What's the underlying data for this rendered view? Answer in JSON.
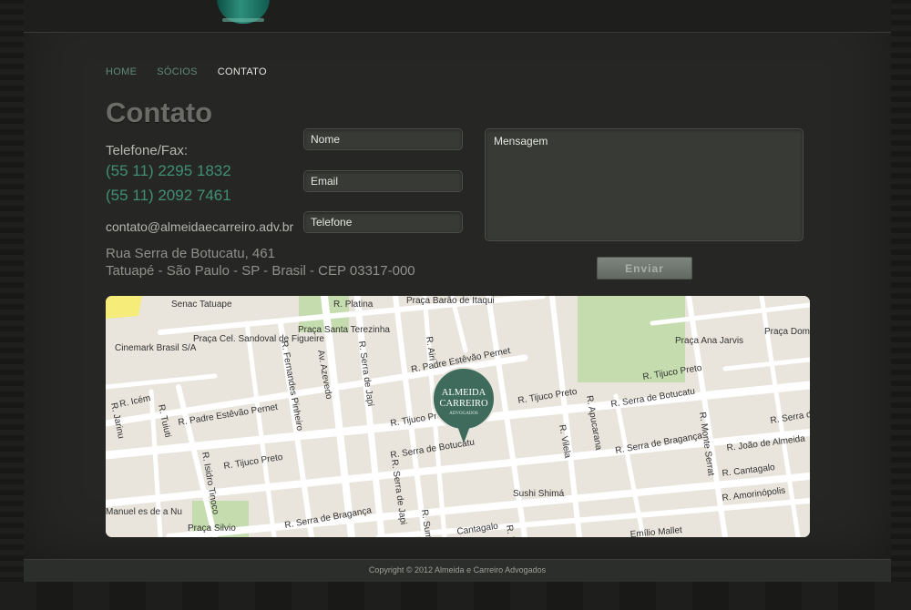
{
  "brand_mark_text": "ALMEIDA CARREIRO",
  "nav": {
    "items": [
      {
        "label": "HOME"
      },
      {
        "label": "SÓCIOS"
      },
      {
        "label": "CONTATO"
      }
    ],
    "active": "CONTATO"
  },
  "contact": {
    "title": "Contato",
    "phone_label": "Telefone/Fax:",
    "phones": [
      "(55 11) 2295 1832",
      "(55 11) 2092 7461"
    ],
    "email": "contato@almeidaecarreiro.adv.br",
    "address_line1": "Rua Serra de Botucatu, 461",
    "address_line2": "Tatuapé - São Paulo - SP - Brasil - CEP 03317-000"
  },
  "form": {
    "name_placeholder": "Nome",
    "email_placeholder": "Email",
    "phone_placeholder": "Telefone",
    "message_placeholder": "Mensagem",
    "send_label": "Enviar"
  },
  "map": {
    "marker": {
      "line1": "ALMEIDA",
      "line2": "CARREIRO",
      "line3": "ADVOGADOS"
    },
    "labels": {
      "senac": "Senac Tatuape",
      "platina": "R. Platina",
      "barao": "Praça Barão de Itaqui",
      "santa_terezinha": "Praça Santa Terezinha",
      "cinemark": "Cinemark Brasil S/A",
      "sandoval": "Praça Cel. Sandoval de Figueire",
      "padre1": "R. Padre Estêvão Pernet",
      "padre2": "R. Padre Estêvão Pernet",
      "icem": "R. Icém",
      "tuiuti": "R. Tuiuti",
      "jarinu": "R. Jarinu",
      "fernandes": "R. Fernandes Pinheiro",
      "azevedo": "Av. Azevedo",
      "japi": "R. Serra de Japi",
      "airi": "R. Airi",
      "tijuco1": "R. Tijuco Preto",
      "tijuco2": "R. Tijuco Preto",
      "tijuco3": "R. Tijuco Preto",
      "tijuco4": "R. Tijuco Preto",
      "ana_jarvis": "Praça Ana Jarvis",
      "dom_justino": "Praça Dom Justino José Santana",
      "botucatu1": "R. Serra de Botucatu",
      "botucatu2": "R. Serra de Botucatu",
      "botucatu3": "R. Serra de",
      "apucarana": "R. Apucarana",
      "vilela": "R. Vilela",
      "braganca1": "R. Serra de Bragança",
      "braganca2": "R. Serra de Bragança",
      "monte_serrat": "R. Monte Serrat",
      "joao": "R. João de Almeida",
      "cantagalo1": "R. Cantagalo",
      "cantagalo2": "Cantagalo",
      "amorinopolis": "R. Amorinópolis",
      "isidro": "R. Isidro Tinoco",
      "japi2": "R. Serra de Japi",
      "sumi": "R. Sumi",
      "sushi": "Sushi Shimá",
      "manuel": "Manuel es de a Nu",
      "silvio": "Praça Silvio",
      "mallet": "Emílio Mallet",
      "ita": "R. Ita"
    }
  },
  "footer": {
    "copyright": "Copyright © 2012 Almeida e Carreiro Advogados"
  }
}
